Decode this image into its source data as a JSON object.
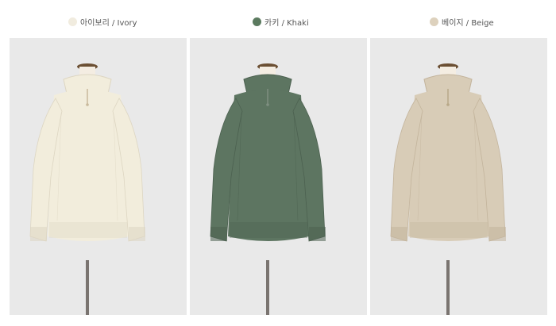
{
  "colors": [
    {
      "label": "아이보리 / Ivory",
      "swatch": "#f1ecdf",
      "garment": "#f2eddc",
      "shade": "#ddd6c2",
      "trim": "#c9b99c"
    },
    {
      "label": "카키 / Khaki",
      "swatch": "#5b7a5f",
      "garment": "#5d7561",
      "shade": "#4c6150",
      "trim": "#7e8f80"
    },
    {
      "label": "베이지 / Beige",
      "swatch": "#ddd1bd",
      "garment": "#d8ccb7",
      "shade": "#c3b49c",
      "trim": "#b8a888"
    }
  ]
}
